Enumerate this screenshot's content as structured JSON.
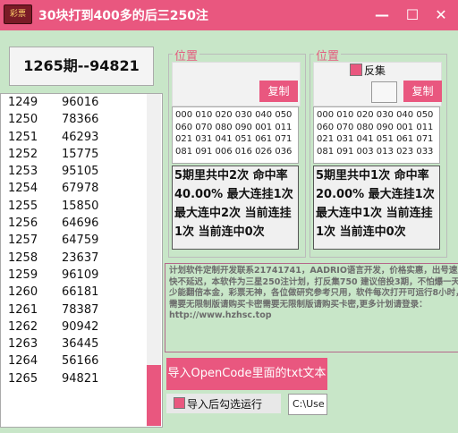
{
  "window": {
    "logo_text": "彩票",
    "title": "30块打到400多的后三250注",
    "min_glyph": "—",
    "max_glyph": "☐",
    "close_glyph": "✕"
  },
  "period": {
    "text": "1265期--94821"
  },
  "history": {
    "rows": [
      {
        "issue": "1249",
        "num": "96016"
      },
      {
        "issue": "1250",
        "num": "78366"
      },
      {
        "issue": "1251",
        "num": "46293"
      },
      {
        "issue": "1252",
        "num": "15775"
      },
      {
        "issue": "1253",
        "num": "95105"
      },
      {
        "issue": "1254",
        "num": "67978"
      },
      {
        "issue": "1255",
        "num": "15850"
      },
      {
        "issue": "1256",
        "num": "64696"
      },
      {
        "issue": "1257",
        "num": "64759"
      },
      {
        "issue": "1258",
        "num": "23637"
      },
      {
        "issue": "1259",
        "num": "96109"
      },
      {
        "issue": "1260",
        "num": "66181"
      },
      {
        "issue": "1261",
        "num": "78387"
      },
      {
        "issue": "1262",
        "num": "90942"
      },
      {
        "issue": "1263",
        "num": "36445"
      },
      {
        "issue": "1264",
        "num": "56166"
      },
      {
        "issue": "1265",
        "num": "94821"
      }
    ]
  },
  "left_group": {
    "title": "位置",
    "copy_label": "复制",
    "numbers": [
      "000 010 020 030 040 050",
      "060 070 080 090 001 011",
      "021 031 041 051 061 071",
      "081 091 006 016 026 036"
    ],
    "stats": "5期里共中2次 命中率40.00% 最大连挂1次 最大连中2次 当前连挂1次 当前连中0次"
  },
  "right_group": {
    "title": "位置",
    "reverse_label": "反集",
    "reverse_checked": true,
    "copy_label": "复制",
    "numbers": [
      "000 010 020 030 040 050",
      "060 070 080 090 001 011",
      "021 031 041 051 061 071",
      "081 091 003 013 023 033"
    ],
    "stats": "5期里共中1次 命中率20.00% 最大连挂1次 最大连中1次 当前连挂1次 当前连中0次"
  },
  "info": {
    "text": "计划软件定制开发联系21741741，AADRIO语言开发，价格实惠，出号速度快不延迟，本软件为三星250注计划，打反集750 建议倍投3期，不怕爆一天至少能翻倍本金，彩票无神，各位做研究参考只用，软件每次打开可运行8小时，需要无限制版请购买卡密需要无限制版请购买卡密,更多计划请登录：",
    "url": "http://www.hzhsc.top"
  },
  "import": {
    "button_label": "导入OpenCode里面的txt文本",
    "run_after_label": "导入后勾选运行",
    "run_after_checked": true,
    "path_value": "C:\\Use"
  },
  "colors": {
    "accent": "#e9577f",
    "background": "#c8e6c8"
  }
}
